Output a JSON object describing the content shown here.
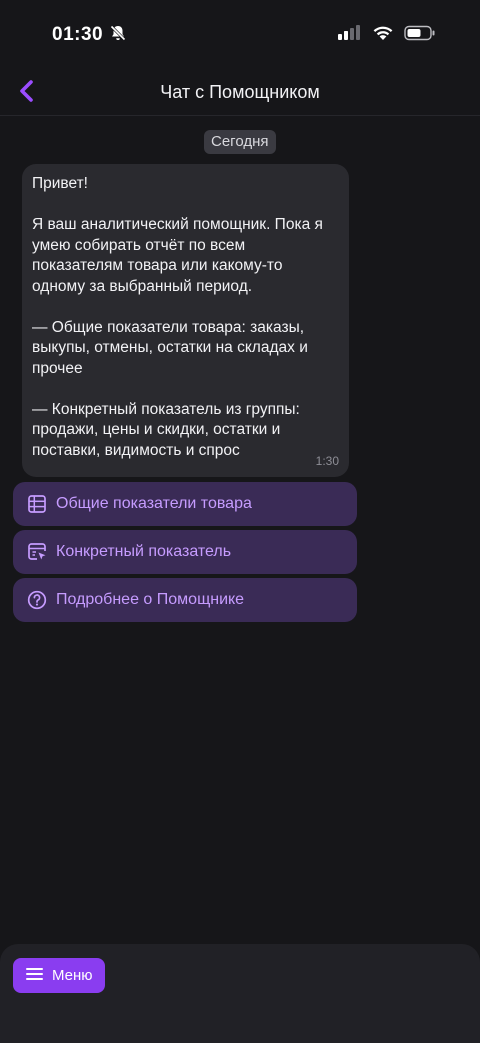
{
  "status_bar": {
    "time": "01:30"
  },
  "header": {
    "title": "Чат с Помощником"
  },
  "chat": {
    "date_label": "Сегодня",
    "message": {
      "paragraphs": [
        "Привет!",
        "Я ваш аналитический помощник. Пока я умею собирать отчёт по всем показателям товара или какому-то одному за выбранный период.",
        "— Общие показатели товара: заказы, выкупы, отмены, остатки на складах и прочее",
        "— Конкретный показатель из группы: продажи, цены и скидки, остатки и поставки, видимость и спрос"
      ],
      "time": "1:30"
    },
    "actions": [
      {
        "label": "Общие показатели товара",
        "icon": "table-icon"
      },
      {
        "label": "Конкретный показатель",
        "icon": "chart-cursor-icon"
      },
      {
        "label": "Подробнее о Помощнике",
        "icon": "question-circle-icon"
      }
    ]
  },
  "bottom_bar": {
    "menu_label": "Меню"
  },
  "colors": {
    "background": "#161619",
    "bubble": "#2a2a2f",
    "accent": "#8a3df0",
    "action_bg": "#3a2b56",
    "action_text": "#c69cff"
  }
}
